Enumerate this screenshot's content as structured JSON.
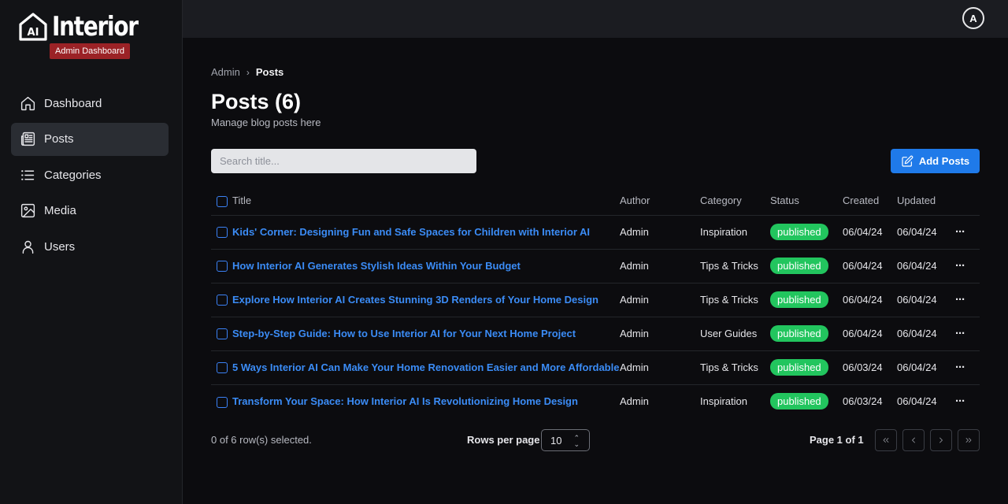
{
  "brand": {
    "logo_mark": "AI",
    "name": "Interior",
    "badge": "Admin Dashboard"
  },
  "sidebar": {
    "items": [
      {
        "label": "Dashboard",
        "icon": "home-icon"
      },
      {
        "label": "Posts",
        "icon": "newspaper-icon",
        "active": true
      },
      {
        "label": "Categories",
        "icon": "list-icon"
      },
      {
        "label": "Media",
        "icon": "image-icon"
      },
      {
        "label": "Users",
        "icon": "user-icon"
      }
    ]
  },
  "topbar": {
    "avatar_initial": "A"
  },
  "breadcrumb": {
    "root": "Admin",
    "current": "Posts"
  },
  "page": {
    "title": "Posts (6)",
    "subtitle": "Manage blog posts here"
  },
  "search": {
    "placeholder": "Search title..."
  },
  "add_button": {
    "label": "Add Posts",
    "icon": "edit-icon"
  },
  "table": {
    "columns": [
      "Title",
      "Author",
      "Category",
      "Status",
      "Created",
      "Updated"
    ],
    "rows": [
      {
        "title": "Kids' Corner: Designing Fun and Safe Spaces for Children with Interior AI",
        "author": "Admin",
        "category": "Inspiration",
        "status": "published",
        "created": "06/04/24",
        "updated": "06/04/24"
      },
      {
        "title": "How Interior AI Generates Stylish Ideas Within Your Budget",
        "author": "Admin",
        "category": "Tips & Tricks",
        "status": "published",
        "created": "06/04/24",
        "updated": "06/04/24"
      },
      {
        "title": "Explore How Interior AI Creates Stunning 3D Renders of Your Home Design",
        "author": "Admin",
        "category": "Tips & Tricks",
        "status": "published",
        "created": "06/04/24",
        "updated": "06/04/24"
      },
      {
        "title": "Step-by-Step Guide: How to Use Interior AI for Your Next Home Project",
        "author": "Admin",
        "category": "User Guides",
        "status": "published",
        "created": "06/04/24",
        "updated": "06/04/24"
      },
      {
        "title": "5 Ways Interior AI Can Make Your Home Renovation Easier and More Affordable",
        "author": "Admin",
        "category": "Tips & Tricks",
        "status": "published",
        "created": "06/03/24",
        "updated": "06/04/24"
      },
      {
        "title": "Transform Your Space: How Interior AI Is Revolutionizing Home Design",
        "author": "Admin",
        "category": "Inspiration",
        "status": "published",
        "created": "06/03/24",
        "updated": "06/04/24"
      }
    ],
    "row_action": "···"
  },
  "footer": {
    "selected_text": "0 of 6 row(s) selected.",
    "rows_per_page_label": "Rows per page",
    "rows_per_page_value": "10",
    "page_info": "Page 1 of 1"
  },
  "colors": {
    "accent": "#1f7ae9",
    "link": "#3b8cf6",
    "status_published": "#22c55e",
    "badge": "#9b2226"
  }
}
